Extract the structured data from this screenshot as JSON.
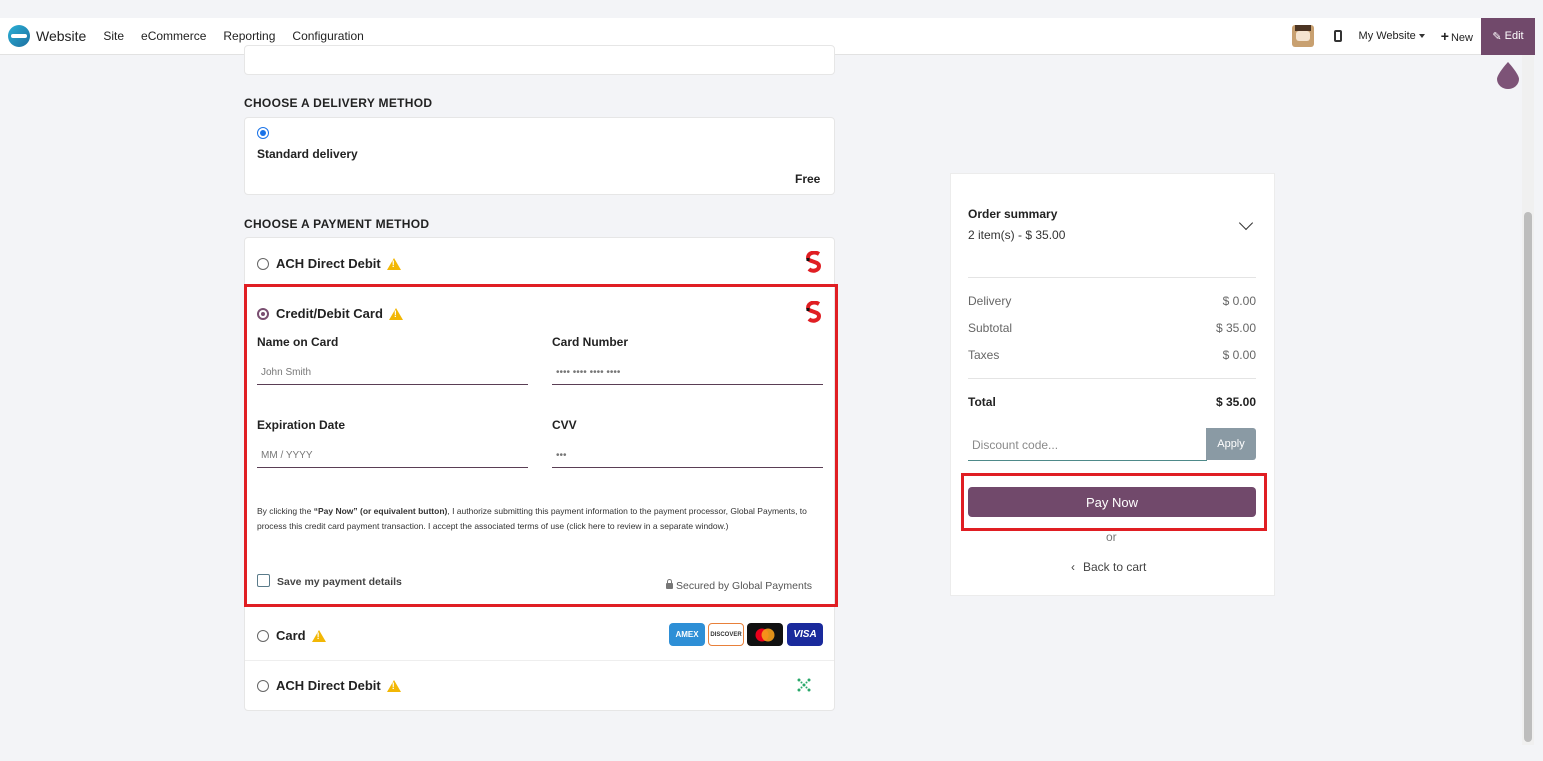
{
  "nav": {
    "brand": "Website",
    "items": [
      "Site",
      "eCommerce",
      "Reporting",
      "Configuration"
    ],
    "my_website": "My Website",
    "new_label": "New",
    "edit_label": "Edit"
  },
  "delivery": {
    "title": "CHOOSE A DELIVERY METHOD",
    "option_name": "Standard delivery",
    "option_price": "Free"
  },
  "payment": {
    "title": "CHOOSE A PAYMENT METHOD",
    "methods": [
      {
        "label": "ACH Direct Debit"
      },
      {
        "label": "Credit/Debit Card"
      },
      {
        "label": "Card"
      },
      {
        "label": "ACH Direct Debit"
      }
    ],
    "card_form": {
      "name_label": "Name on Card",
      "name_placeholder": "John Smith",
      "number_label": "Card Number",
      "number_placeholder": "•••• •••• •••• ••••",
      "expiry_label": "Expiration Date",
      "expiry_placeholder": "MM / YYYY",
      "cvv_label": "CVV",
      "cvv_placeholder": "•••",
      "consent_prefix": "By clicking the ",
      "consent_bold": "“Pay Now” (or equivalent button)",
      "consent_text": ", I authorize submitting this payment information to the payment processor, Global Payments, to process this credit card payment transaction. I accept the associated terms of use (click here to review in a separate window.)",
      "save_label": "Save my payment details",
      "secured_label": "Secured by Global Payments"
    },
    "card_brands": [
      "AMEX",
      "DISCOVER",
      "Mastercard",
      "VISA"
    ]
  },
  "summary": {
    "title": "Order summary",
    "items_line": "2 item(s) -  $ 35.00",
    "rows": [
      {
        "label": "Delivery",
        "value": "$ 0.00"
      },
      {
        "label": "Subtotal",
        "value": "$ 35.00"
      },
      {
        "label": "Taxes",
        "value": "$ 0.00"
      }
    ],
    "total_label": "Total",
    "total_value": "$ 35.00",
    "discount_placeholder": "Discount code...",
    "apply_label": "Apply",
    "pay_now_label": "Pay Now",
    "or_label": "or",
    "back_label": "Back to cart"
  },
  "colors": {
    "brand": "#71496b",
    "highlight": "#e01e23"
  }
}
